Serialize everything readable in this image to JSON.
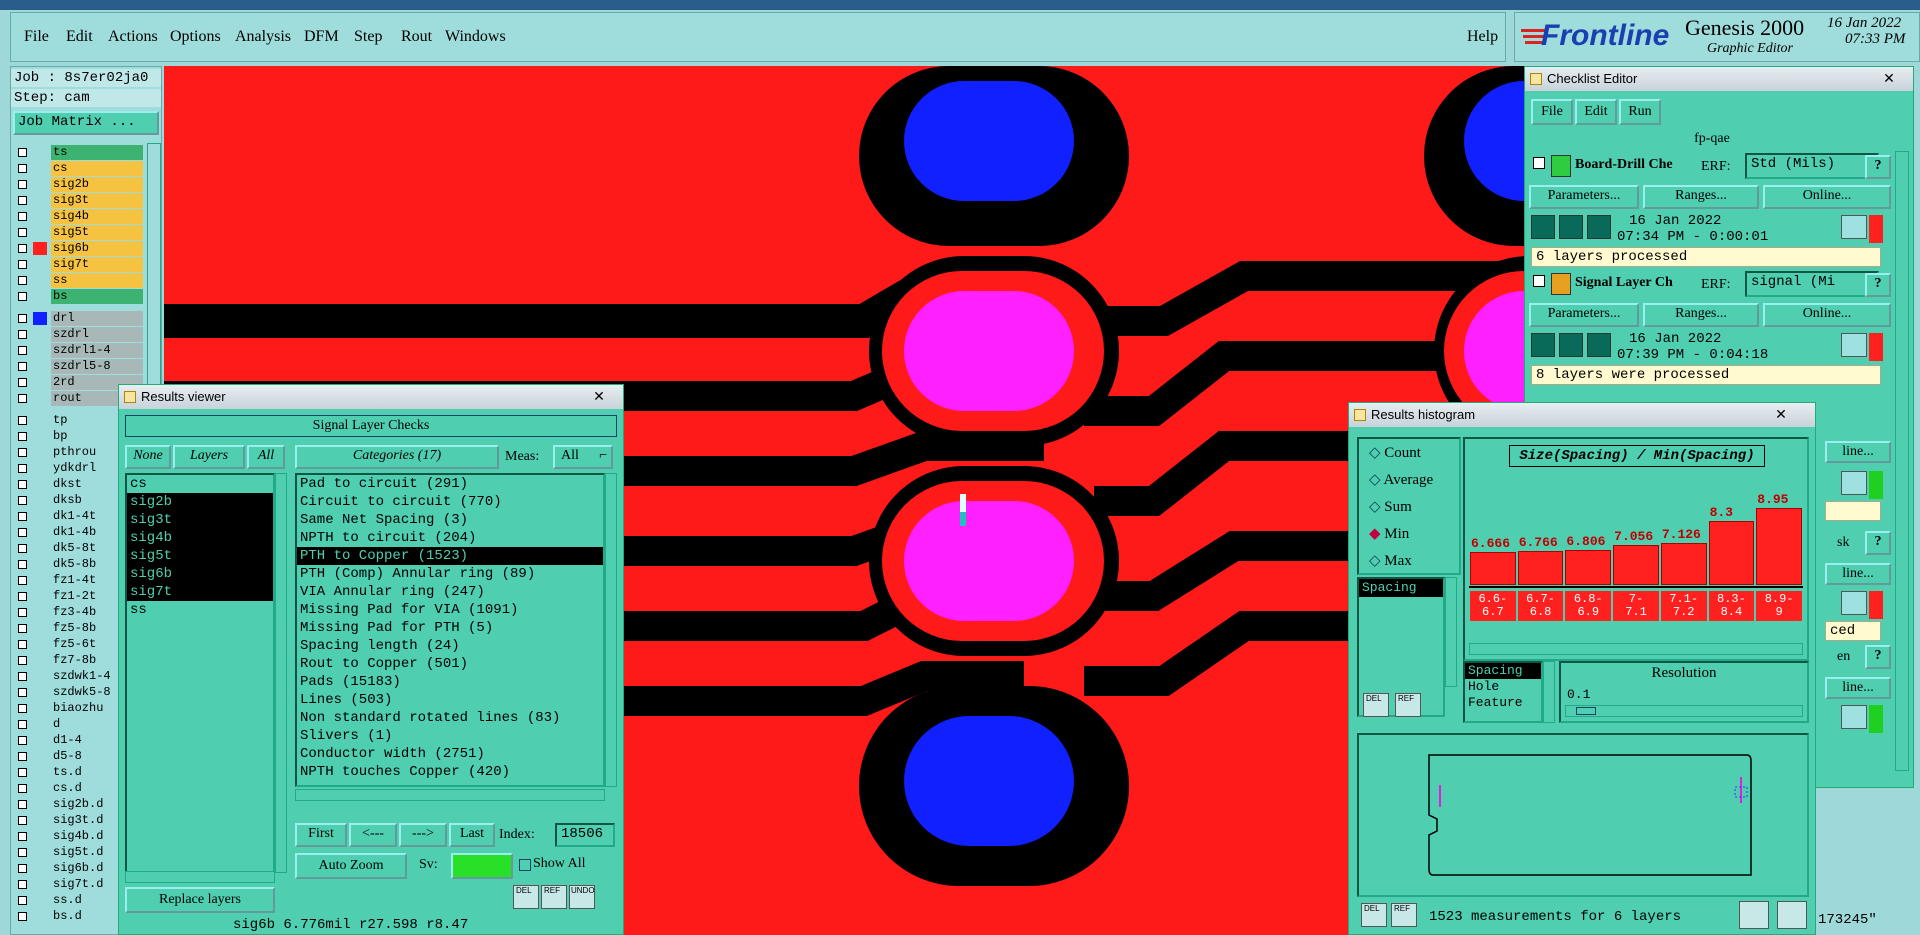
{
  "menu": {
    "items": [
      "File",
      "Edit",
      "Actions",
      "Options",
      "Analysis",
      "DFM",
      "Step",
      "Rout",
      "Windows"
    ],
    "help": "Help"
  },
  "brand": {
    "logo": "Frontline",
    "product": "Genesis 2000",
    "subtitle": "Graphic Editor",
    "date": "16 Jan 2022",
    "time": "07:33 PM"
  },
  "job": {
    "job_label": "Job : 8s7er02ja0",
    "step_label": "Step: cam",
    "matrix_button": "Job Matrix ..."
  },
  "layers": {
    "signal": [
      {
        "name": "ts",
        "color": "#3cb371"
      },
      {
        "name": "cs",
        "color": "#f5c242"
      },
      {
        "name": "sig2b",
        "color": "#f5c242"
      },
      {
        "name": "sig3t",
        "color": "#f5c242"
      },
      {
        "name": "sig4b",
        "color": "#f5c242"
      },
      {
        "name": "sig5t",
        "color": "#f5c242"
      },
      {
        "name": "sig6b",
        "color": "#f5c242",
        "active": true
      },
      {
        "name": "sig7t",
        "color": "#f5c242"
      },
      {
        "name": "ss",
        "color": "#f5c242"
      },
      {
        "name": "bs",
        "color": "#3cb371"
      }
    ],
    "drill": [
      "drl",
      "szdrl",
      "szdrl1-4",
      "szdrl5-8",
      "2rd",
      "rout"
    ],
    "misc": [
      "tp",
      "bp",
      "pthrou",
      "ydkdrl",
      "dkst",
      "dksb",
      "dk1-4t",
      "dk1-4b",
      "dk5-8t",
      "dk5-8b",
      "fz1-4t",
      "fz1-2t",
      "fz3-4b",
      "fz5-8b",
      "fz5-6t",
      "fz7-8b",
      "szdwk1-4",
      "szdwk5-8",
      "biaozhu",
      "d",
      "d1-4",
      "d5-8",
      "ts.d",
      "cs.d",
      "sig2b.d",
      "sig3t.d",
      "sig4b.d",
      "sig5t.d",
      "sig6b.d",
      "sig7t.d",
      "ss.d",
      "bs.d"
    ]
  },
  "results_viewer": {
    "title": "Results viewer",
    "header": "Signal Layer Checks",
    "none_btn": "None",
    "layers_btn": "Layers",
    "all_btn": "All",
    "categories_btn": "Categories (17)",
    "meas_label": "Meas:",
    "meas_value": "All",
    "layers": [
      {
        "name": "cs",
        "selected": false
      },
      {
        "name": "sig2b",
        "selected": true
      },
      {
        "name": "sig3t",
        "selected": true
      },
      {
        "name": "sig4b",
        "selected": true
      },
      {
        "name": "sig5t",
        "selected": true
      },
      {
        "name": "sig6b",
        "selected": true
      },
      {
        "name": "sig7t",
        "selected": true
      },
      {
        "name": "ss",
        "selected": false
      }
    ],
    "categories": [
      {
        "label": "Pad to circuit (291)",
        "selected": false
      },
      {
        "label": "Circuit to circuit (770)",
        "selected": false
      },
      {
        "label": "Same Net Spacing (3)",
        "selected": false
      },
      {
        "label": "NPTH to circuit (204)",
        "selected": false
      },
      {
        "label": "PTH to Copper (1523)",
        "selected": true
      },
      {
        "label": "PTH (Comp) Annular ring (89)",
        "selected": false
      },
      {
        "label": "VIA Annular ring (247)",
        "selected": false
      },
      {
        "label": "Missing Pad for VIA (1091)",
        "selected": false
      },
      {
        "label": "Missing Pad for PTH (5)",
        "selected": false
      },
      {
        "label": "Spacing length (24)",
        "selected": false
      },
      {
        "label": "Rout to Copper (501)",
        "selected": false
      },
      {
        "label": "Pads (15183)",
        "selected": false
      },
      {
        "label": "Lines (503)",
        "selected": false
      },
      {
        "label": "Non standard rotated lines (83)",
        "selected": false
      },
      {
        "label": "Slivers (1)",
        "selected": false
      },
      {
        "label": "Conductor width (2751)",
        "selected": false
      },
      {
        "label": "NPTH touches Copper (420)",
        "selected": false
      }
    ],
    "first_btn": "First",
    "prev_btn": "<---",
    "next_btn": "--->",
    "last_btn": "Last",
    "index_label": "Index:",
    "index_value": "18506",
    "zoom_btn": "Auto Zoom",
    "sv_label": "Sv:",
    "show_all": "Show All",
    "replace_btn": "Replace layers",
    "del": "DEL",
    "ref": "REF",
    "undo": "UNDO",
    "status": "sig6b 6.776mil  r27.598  r8.47"
  },
  "checklist": {
    "title": "Checklist Editor",
    "menu": [
      "File",
      "Edit",
      "Run"
    ],
    "name": "fp-qae",
    "checks": [
      {
        "name": "Board-Drill Che",
        "erf_label": "ERF:",
        "erf": "Std (Mils)",
        "params": "Parameters...",
        "ranges": "Ranges...",
        "online": "Online...",
        "date": "16 Jan 2022",
        "time": "07:34 PM - 0:00:01",
        "status": "6 layers processed",
        "icon_color": "#2ecc40"
      },
      {
        "name": "Signal Layer Ch",
        "erf_label": "ERF:",
        "erf": "signal (Mi",
        "params": "Parameters...",
        "ranges": "Ranges...",
        "online": "Online...",
        "date": "16 Jan 2022",
        "time": "07:39 PM - 0:04:18",
        "status": "8 layers were processed",
        "icon_color": "#e8a020"
      }
    ],
    "partial": [
      "line...",
      "ced",
      "sk",
      "en"
    ]
  },
  "histogram": {
    "title": "Results histogram",
    "modes": [
      {
        "label": "Count",
        "selected": false
      },
      {
        "label": "Average",
        "selected": false
      },
      {
        "label": "Sum",
        "selected": false
      },
      {
        "label": "Min",
        "selected": true
      },
      {
        "label": "Max",
        "selected": false
      }
    ],
    "measures": [
      "Spacing"
    ],
    "chart_title": "Size(Spacing) / Min(Spacing)",
    "resolution_label": "Resolution",
    "resolution_value": "0.1",
    "type_list": [
      "Spacing",
      "Hole",
      "Feature"
    ],
    "footer": "1523 measurements for 6 layers",
    "del": "DEL",
    "ref": "REF",
    "side_text": "173245\""
  },
  "chart_data": {
    "type": "bar",
    "title": "Size(Spacing) / Min(Spacing)",
    "categories": [
      "6.6-6.7",
      "6.7-6.8",
      "6.8-6.9",
      "7-7.1",
      "7.1-7.2",
      "8.3-8.4",
      "8.9-9"
    ],
    "values": [
      6.666,
      6.766,
      6.806,
      7.056,
      7.126,
      8.3,
      8.95
    ],
    "value_labels": [
      "6.666",
      "6.766",
      "6.806",
      "7.056",
      "7.126",
      "8.3",
      "8.95"
    ],
    "bin_labels_top": [
      "6.6-",
      "6.7-",
      "6.8-",
      "7-",
      "7.1-",
      "8.3-",
      "8.9-"
    ],
    "bin_labels_bottom": [
      "6.7",
      "6.8",
      "6.9",
      "7.1",
      "7.2",
      "8.4",
      "9"
    ],
    "colors": {
      "bar": "#ff2020",
      "label": "#c00000"
    }
  },
  "colors": {
    "canvas_bg": "#ff1a1a",
    "copper_clear": "#000000",
    "pad_blue": "#1020ff",
    "pad_magenta": "#ff20ff",
    "panel": "#4fcfb0",
    "menu": "#9fdcdc"
  }
}
